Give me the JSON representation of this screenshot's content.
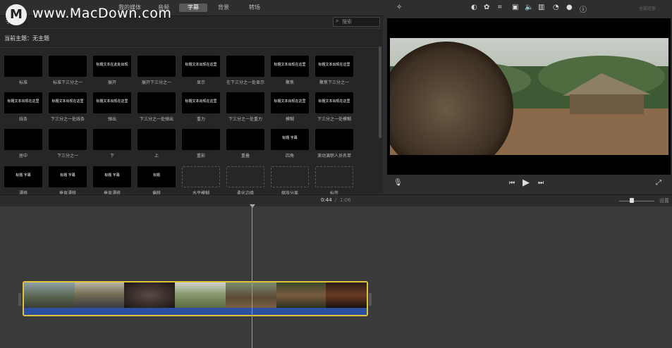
{
  "header": {
    "tabs": [
      {
        "label": "我的媒体",
        "active": false
      },
      {
        "label": "音频",
        "active": false
      },
      {
        "label": "字幕",
        "active": true
      },
      {
        "label": "背景",
        "active": false
      },
      {
        "label": "转场",
        "active": false
      }
    ],
    "section_label": "字幕 ≫",
    "search_placeholder": "搜索",
    "theme_label": "当前主题：无主题"
  },
  "titles": [
    {
      "thumb": "",
      "label": "标准"
    },
    {
      "thumb": "",
      "label": "标准下三分之一"
    },
    {
      "thumb": "标题文本在此处出现",
      "label": "展开"
    },
    {
      "thumb": "",
      "label": "展开下三分之一"
    },
    {
      "thumb": "标题文本出现在这里",
      "label": "显示"
    },
    {
      "thumb": "",
      "label": "在下三分之一处显示"
    },
    {
      "thumb": "标题文本出现在这里",
      "label": "聚焦"
    },
    {
      "thumb": "标题文本出现在这里",
      "label": "聚焦下三分之一"
    },
    {
      "thumb": "标题文本出现在这里",
      "label": "线条"
    },
    {
      "thumb": "标题文本出现在这里",
      "label": "下三分之一处线条"
    },
    {
      "thumb": "标题文本出现在这里",
      "label": "弹出"
    },
    {
      "thumb": "",
      "label": "下三分之一处弹出"
    },
    {
      "thumb": "标题文本出现在这里",
      "label": "重力"
    },
    {
      "thumb": "",
      "label": "下三分之一处重力"
    },
    {
      "thumb": "标题文本出现在这里",
      "label": "模糊"
    },
    {
      "thumb": "标题文本出现在这里",
      "label": "下三分之一处模糊"
    },
    {
      "thumb": "",
      "label": "居中"
    },
    {
      "thumb": "",
      "label": "下三分之一"
    },
    {
      "thumb": "",
      "label": "下"
    },
    {
      "thumb": "",
      "label": "上"
    },
    {
      "thumb": "",
      "label": "重影"
    },
    {
      "thumb": "",
      "label": "重叠"
    },
    {
      "thumb": "标题 字幕",
      "label": "四角"
    },
    {
      "thumb": "",
      "label": "滚动演职人员名单"
    },
    {
      "thumb": "标题 字幕",
      "label": "漂移"
    },
    {
      "thumb": "标题 字幕",
      "label": "垂直漂移"
    },
    {
      "thumb": "标题 字幕",
      "label": "垂直漂移"
    },
    {
      "thumb": "标题",
      "label": "偏移"
    },
    {
      "thumb": "",
      "label": "水平模糊",
      "empty": true
    },
    {
      "thumb": "",
      "label": "柔化边缘",
      "empty": true
    },
    {
      "thumb": "",
      "label": "缩放分离",
      "empty": true
    },
    {
      "thumb": "",
      "label": "标签",
      "empty": true
    }
  ],
  "viewer": {
    "tools": [
      "magic-wand-icon",
      "color-balance-icon",
      "color-palette-icon",
      "crop-icon",
      "camera-icon",
      "volume-icon",
      "equalizer-icon",
      "speed-icon",
      "filter-icon",
      "info-icon"
    ],
    "reset_label": "全部还原"
  },
  "timeline": {
    "current_time": "0:44",
    "separator": "/",
    "total_time": "1:06",
    "settings_label": "设置",
    "zoom_level": 0.3
  },
  "watermark": {
    "logo_letter": "M",
    "text": "www.MacDown.com"
  },
  "colors": {
    "selection_yellow": "#e0c33a",
    "audio_blue": "#2d4fa0",
    "active_tab": "#595959"
  }
}
